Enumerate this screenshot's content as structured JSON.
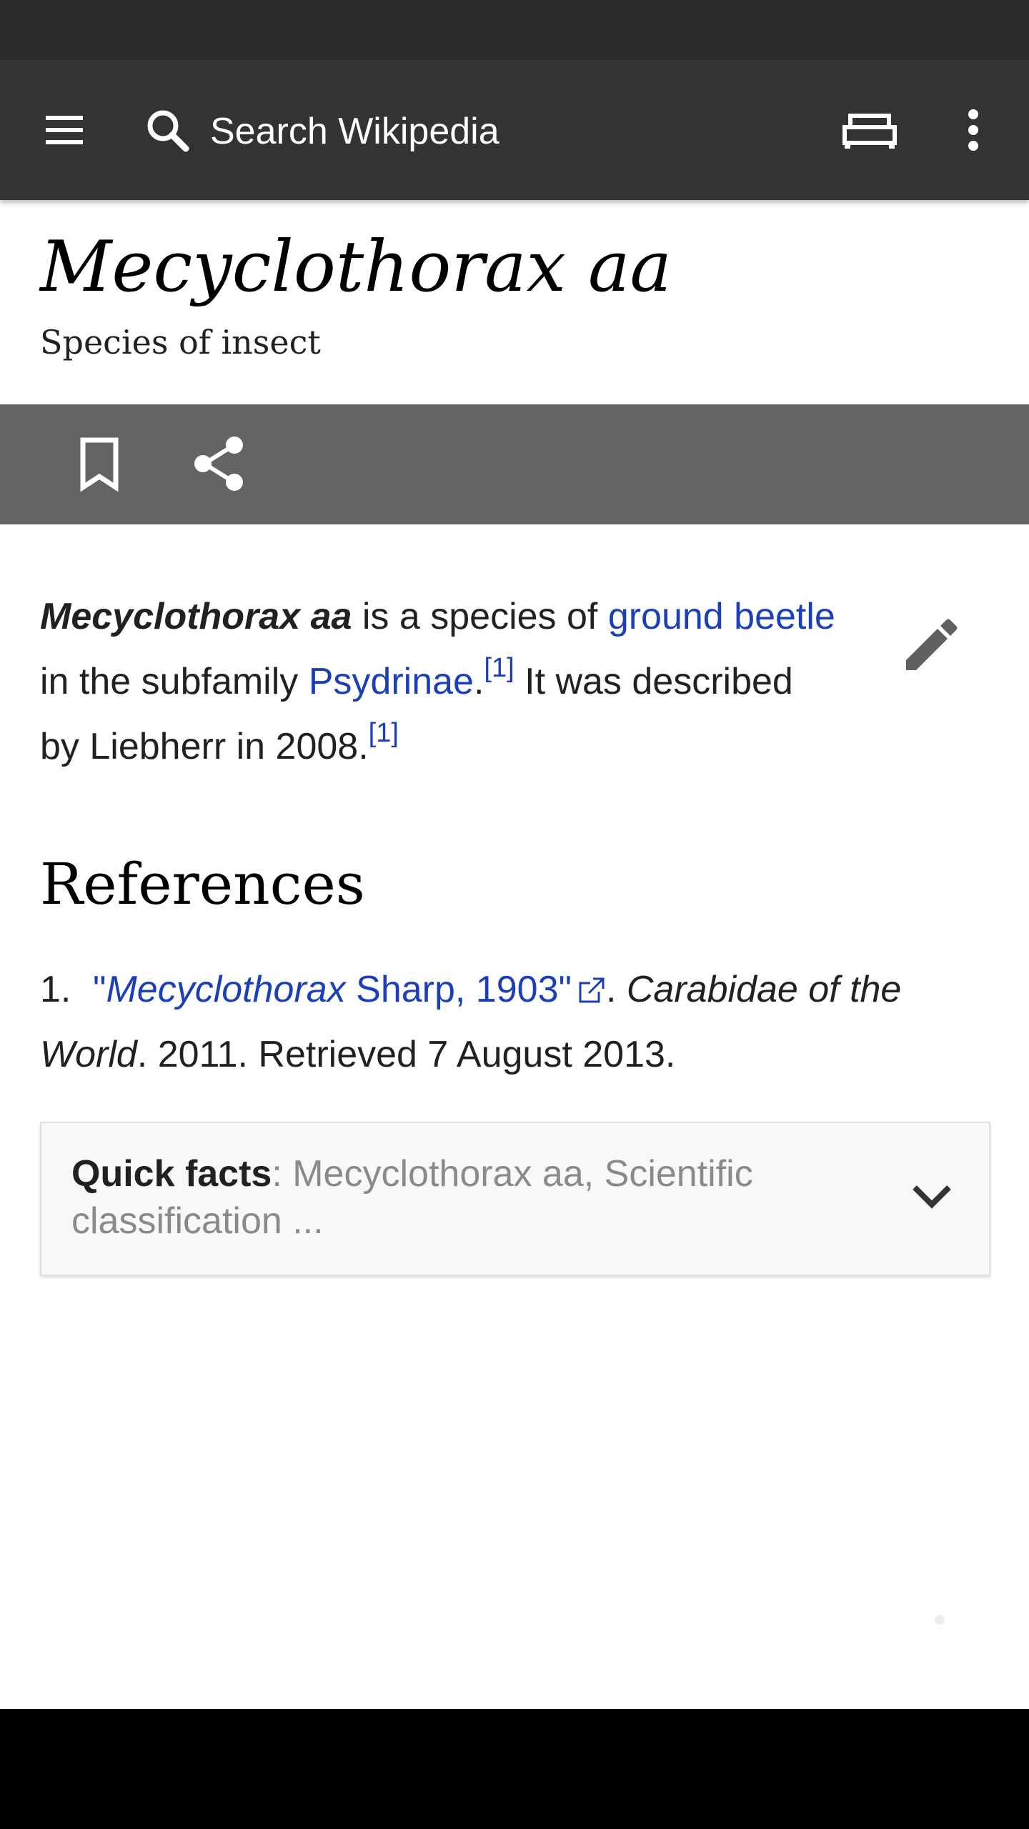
{
  "toolbar": {
    "search_placeholder": "Search Wikipedia",
    "menu_icon": "hamburger-menu-icon",
    "search_icon": "search-icon",
    "tabs_icon": "tabs-icon",
    "overflow_icon": "more-vert-icon"
  },
  "article": {
    "title": "Mecyclothorax aa",
    "description": "Species of insect",
    "lead": {
      "bold_name": "Mecyclothorax aa",
      "text1": " is a species of ",
      "link1": "ground beetle",
      "text2": " in the subfamily ",
      "link2": "Psydrinae",
      "text3": ".",
      "ref1": "[1]",
      "text4": " It was described by Liebherr in 2008.",
      "ref2": "[1]"
    },
    "references_heading": "References",
    "references": [
      {
        "number": "1.",
        "link_open_quote": "\"",
        "link_italic": "Mecyclothorax",
        "link_rest": " Sharp, 1903\"",
        "after_link": ". ",
        "source_italic": "Carabidae of the World",
        "tail": ". 2011. Retrieved 7 August 2013."
      }
    ]
  },
  "action_bar": {
    "bookmark_icon": "bookmark-icon",
    "share_icon": "share-icon"
  },
  "quick_facts": {
    "label": "Quick facts",
    "summary": ": Mecyclothorax aa, Scientific classification ..."
  },
  "colors": {
    "toolbar": "#333333",
    "action_bar": "#646464",
    "link": "#1a3fb8"
  }
}
